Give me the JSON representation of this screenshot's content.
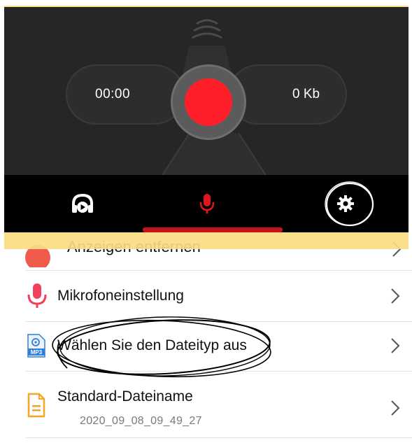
{
  "recorder": {
    "time": "00:00",
    "size": "0 Kb",
    "record_icon": "record-icon"
  },
  "tabs": [
    {
      "name": "playback",
      "icon": "headphones-play-icon"
    },
    {
      "name": "record",
      "icon": "microphone-icon",
      "active": true
    },
    {
      "name": "settings",
      "icon": "gear-icon"
    }
  ],
  "settings": {
    "partial_item": "Anzeigen entfernen",
    "items": [
      {
        "label": "Mikrofoneinstellung",
        "icon": "microphone-icon"
      },
      {
        "label": "Wählen Sie den Dateityp aus",
        "icon": "mp3-file-icon"
      },
      {
        "label": "Standard-Dateiname",
        "sub": "2020_09_08_09_49_27",
        "icon": "document-icon"
      }
    ]
  },
  "colors": {
    "record_red": "#ff1f2a",
    "tab_active_red": "#e0161e",
    "dark_bg": "#262626",
    "highlight_yellow": "#fbdf8d",
    "mic_pink": "#f2405c",
    "doc_orange": "#f5a623",
    "mp3_blue": "#2f7fd8"
  }
}
